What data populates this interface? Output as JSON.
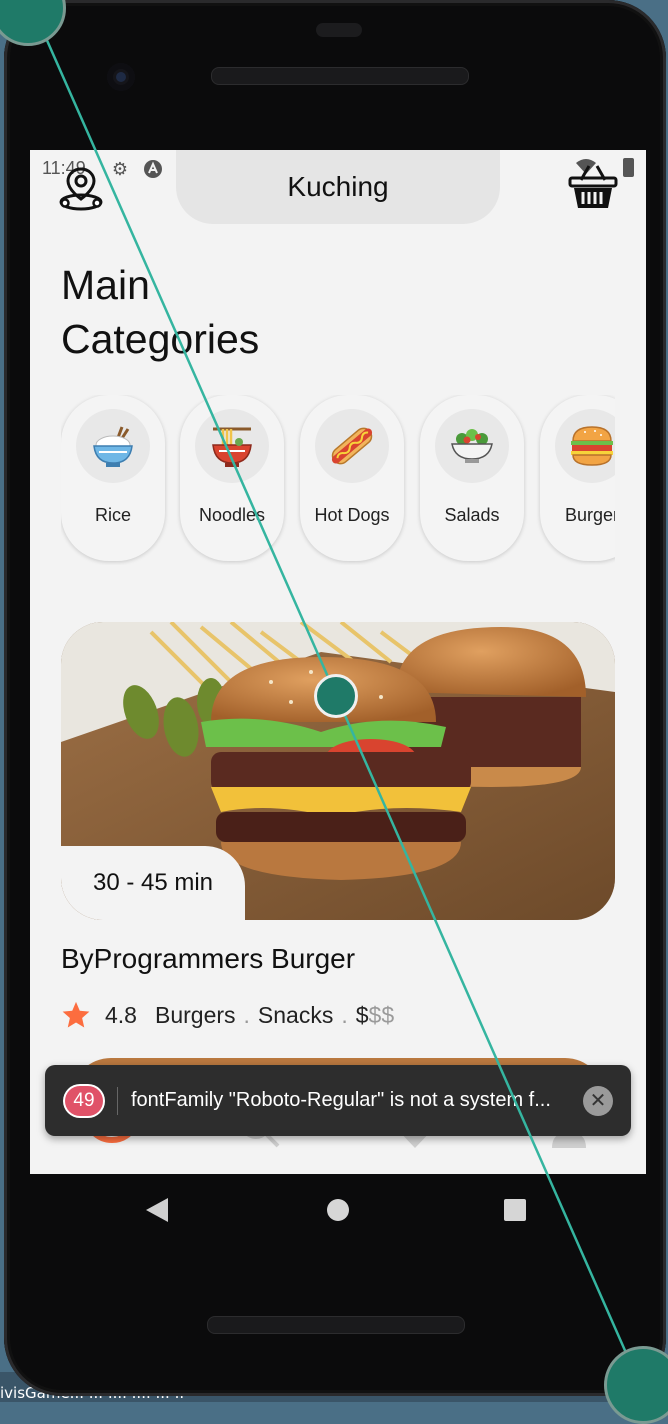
{
  "desktop": {
    "caption": "ivisGame... ... .... ....  ...  .."
  },
  "status_bar": {
    "time": "11:49"
  },
  "header": {
    "location": "Kuching",
    "location_icon": "location-pin-icon",
    "cart_icon": "basket-icon"
  },
  "main": {
    "title_line1": "Main",
    "title_line2": "Categories"
  },
  "categories": [
    {
      "label": "Rice",
      "icon": "rice-bowl-icon"
    },
    {
      "label": "Noodles",
      "icon": "noodles-icon"
    },
    {
      "label": "Hot Dogs",
      "icon": "hot-dog-icon"
    },
    {
      "label": "Salads",
      "icon": "salad-icon"
    },
    {
      "label": "Burger",
      "icon": "burger-icon"
    }
  ],
  "restaurant": {
    "duration": "30 - 45 min",
    "name": "ByProgrammers Burger",
    "rating": "4.8",
    "tags": [
      "Burgers",
      "Snacks"
    ],
    "separator": ".",
    "price_active": "$",
    "price_inactive": "$$"
  },
  "bottom_nav": [
    {
      "icon": "home-icon",
      "active": true
    },
    {
      "icon": "search-icon",
      "active": false
    },
    {
      "icon": "heart-icon",
      "active": false
    },
    {
      "icon": "user-icon",
      "active": false
    }
  ],
  "toast": {
    "count": "49",
    "message": "fontFamily \"Roboto-Regular\" is not a system f..."
  },
  "colors": {
    "accent": "#fc6d3f",
    "screen_bg": "#f3f3f3",
    "toast_bg": "#2d2d2d",
    "badge": "#e05268",
    "touch": "#1f7a68"
  }
}
